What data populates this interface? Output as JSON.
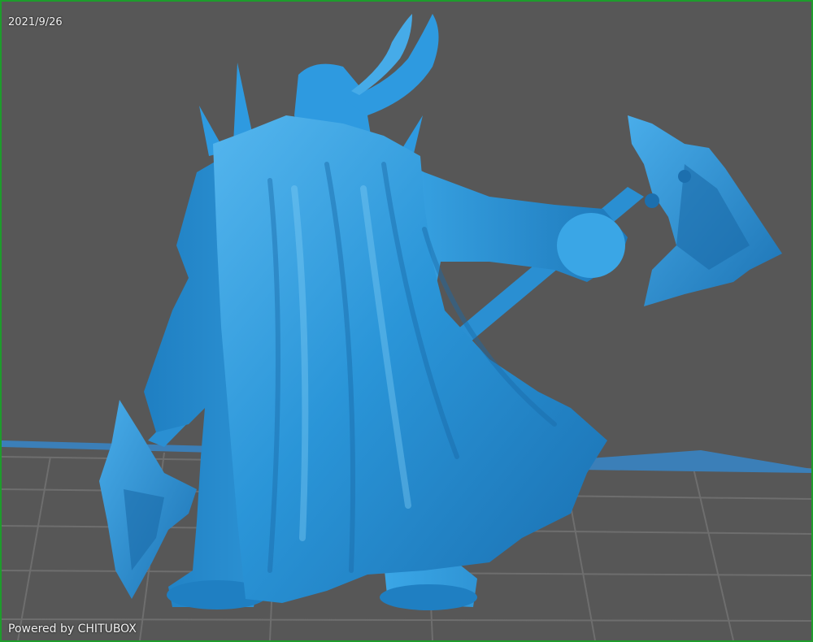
{
  "viewport": {
    "date_stamp": "2021/9/26",
    "watermark": "Powered by CHITUBOX"
  },
  "colors": {
    "background": "#575757",
    "border": "#1e9d2c",
    "model": "#2a95d8",
    "grid_line": "#6e6e6e",
    "build_plate": "#3b7fb8"
  },
  "model": {
    "subject": "horned knight miniature with cape and two axes",
    "view": "rear three-quarter"
  }
}
